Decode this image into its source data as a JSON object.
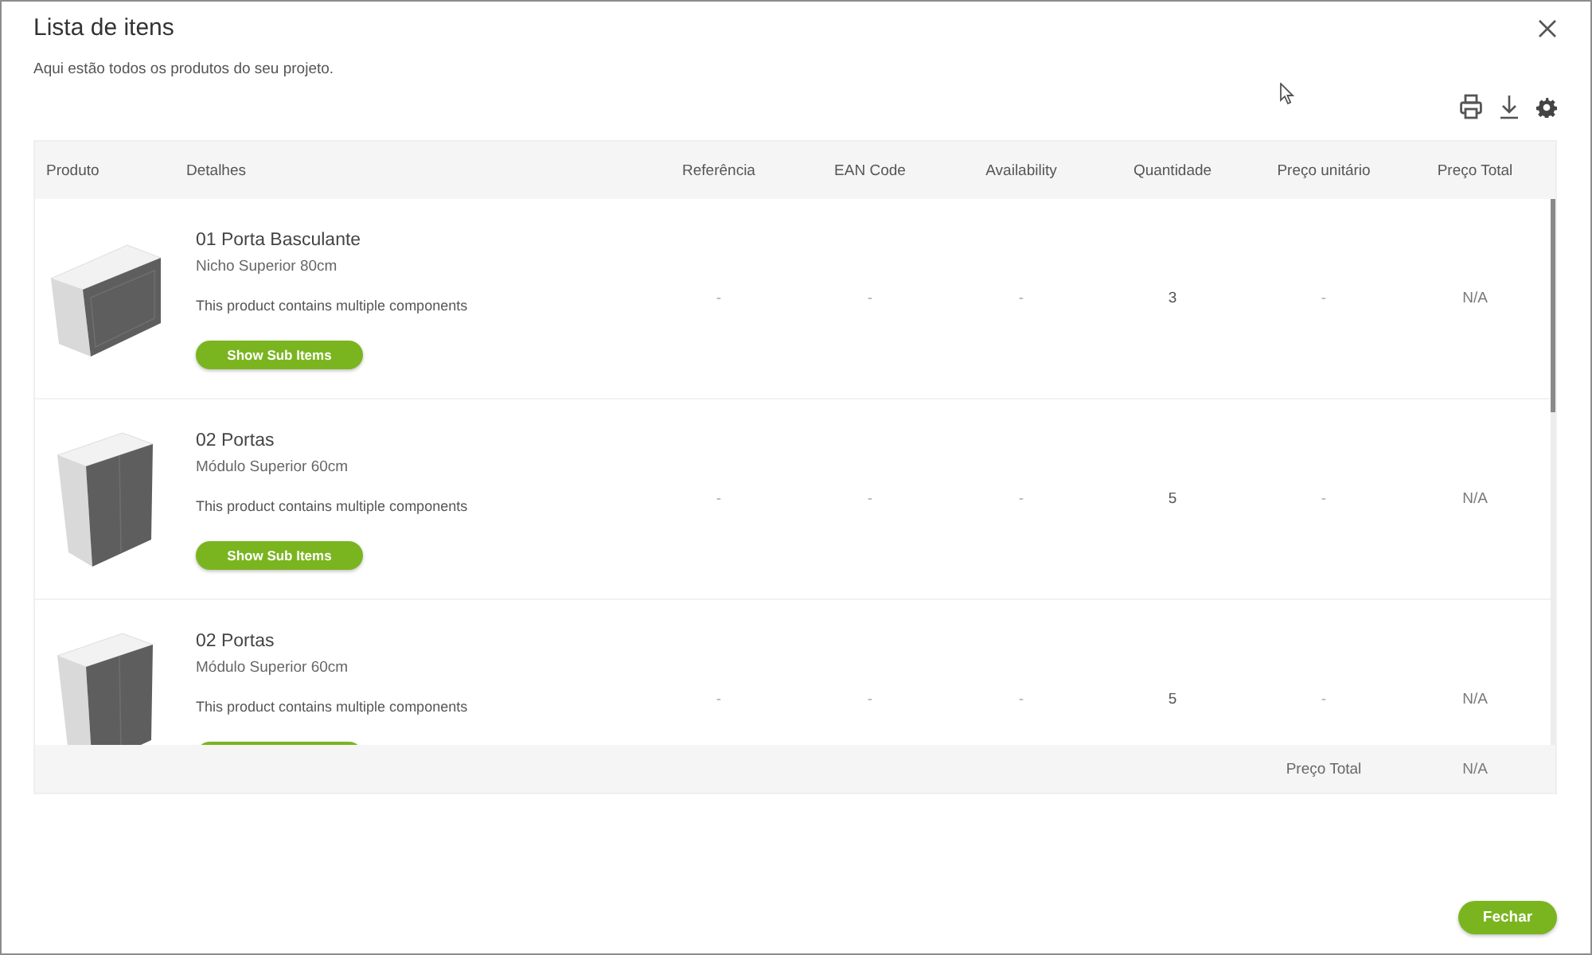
{
  "dialog": {
    "title": "Lista de itens",
    "subtitle": "Aqui estão todos os produtos do seu projeto."
  },
  "table": {
    "columns": [
      "Produto",
      "Detalhes",
      "Referência",
      "EAN Code",
      "Availability",
      "Quantidade",
      "Preço unitário",
      "Preço Total"
    ],
    "rows": [
      {
        "kind": "wide",
        "name": "01 Porta Basculante",
        "description": "Nicho Superior 80cm",
        "note": "This product contains multiple components",
        "sub_items_button": true,
        "sub_items_label": "Show Sub Items",
        "reference": "-",
        "ean_code": "-",
        "availability": "-",
        "quantity": "3",
        "unit_price": "-",
        "total_price": "N/A"
      },
      {
        "kind": "tall",
        "name": "02 Portas",
        "description": "Módulo Superior 60cm",
        "note": "This product contains multiple components",
        "sub_items_button": true,
        "sub_items_label": "Show Sub Items",
        "reference": "-",
        "ean_code": "-",
        "availability": "-",
        "quantity": "5",
        "unit_price": "-",
        "total_price": "N/A"
      },
      {
        "kind": "tall",
        "name": "02 Portas",
        "description": "Módulo Superior 60cm",
        "note": "This product contains multiple components",
        "sub_items_button": true,
        "reference": "-",
        "ean_code": "-",
        "availability": "-",
        "quantity": "5",
        "unit_price": "-",
        "total_price": "N/A"
      }
    ],
    "footer": {
      "label": "Preço Total",
      "value": "N/A"
    }
  },
  "close_button": "Fechar"
}
